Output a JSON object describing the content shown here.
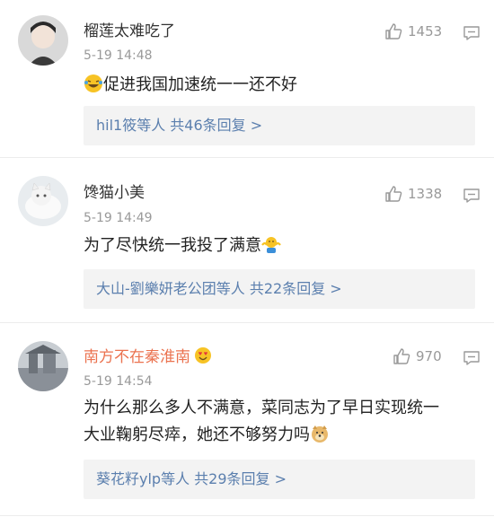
{
  "comments": [
    {
      "username": "榴莲太难吃了",
      "time": "5-19 14:48",
      "likes": "1453",
      "text": "促进我国加速统一一还不好",
      "emoji": "laughing-tears",
      "replies": "hil1筱等人 共46条回复 >"
    },
    {
      "username": "馋猫小美",
      "time": "5-19 14:49",
      "likes": "1338",
      "text": "为了尽快统一我投了满意",
      "emoji": "shrug",
      "replies": "大山-劉樂妍老公团等人 共22条回复 >"
    },
    {
      "username": "南方不在秦淮南",
      "time": "5-19 14:54",
      "likes": "970",
      "text_line1": "为什么那么多人不满意，菜同志为了早日实现统一",
      "text_line2": "大业鞠躬尽瘁，她还不够努力吗",
      "emoji": "doge",
      "badge": "heart-eyes",
      "replies": "葵花籽ylp等人 共29条回复 >"
    }
  ],
  "colors": {
    "vip_name": "#eb7350",
    "reply_link": "#5b7fae",
    "meta": "#999999"
  }
}
